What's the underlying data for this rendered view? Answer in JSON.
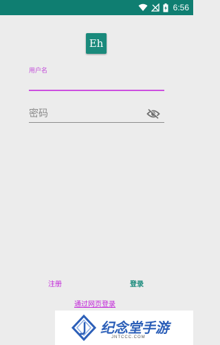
{
  "status_bar": {
    "time": "6:56",
    "background_color": "#0f7e71",
    "icons": [
      "wifi-icon",
      "no-signal-icon",
      "battery-charging-icon"
    ]
  },
  "app": {
    "logo_text": "Eh",
    "logo_color": "#1a8a7c"
  },
  "form": {
    "username_label": "用户名",
    "username_value": "",
    "username_focus_color": "#cc4fe0",
    "password_placeholder": "密码",
    "password_value": "",
    "password_toggle_icon": "eye-off-icon"
  },
  "actions": {
    "register_label": "注册",
    "login_label": "登录",
    "web_login_label": "通过网页登录",
    "accent_color": "#c227d9"
  },
  "watermark": {
    "title": "纪念堂手游",
    "subtitle": "JNTCCC.COM"
  }
}
